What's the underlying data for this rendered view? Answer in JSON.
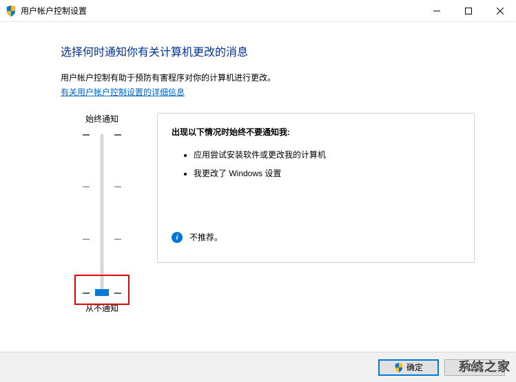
{
  "window": {
    "title": "用户帐户控制设置"
  },
  "content": {
    "heading": "选择何时通知你有关计算机更改的消息",
    "description": "用户帐户控制有助于预防有害程序对你的计算机进行更改。",
    "link": "有关用户帐户控制设置的详细信息"
  },
  "slider": {
    "topLabel": "始终通知",
    "bottomLabel": "从不通知",
    "position": 3,
    "levels": 4
  },
  "infoBox": {
    "title": "出现以下情况时始终不要通知我:",
    "items": [
      "应用尝试安装软件或更改我的计算机",
      "我更改了 Windows 设置"
    ],
    "recommendation": "不推荐。"
  },
  "footer": {
    "okLabel": "确定",
    "cancelLabel": "取消"
  },
  "watermark": "系统之家"
}
